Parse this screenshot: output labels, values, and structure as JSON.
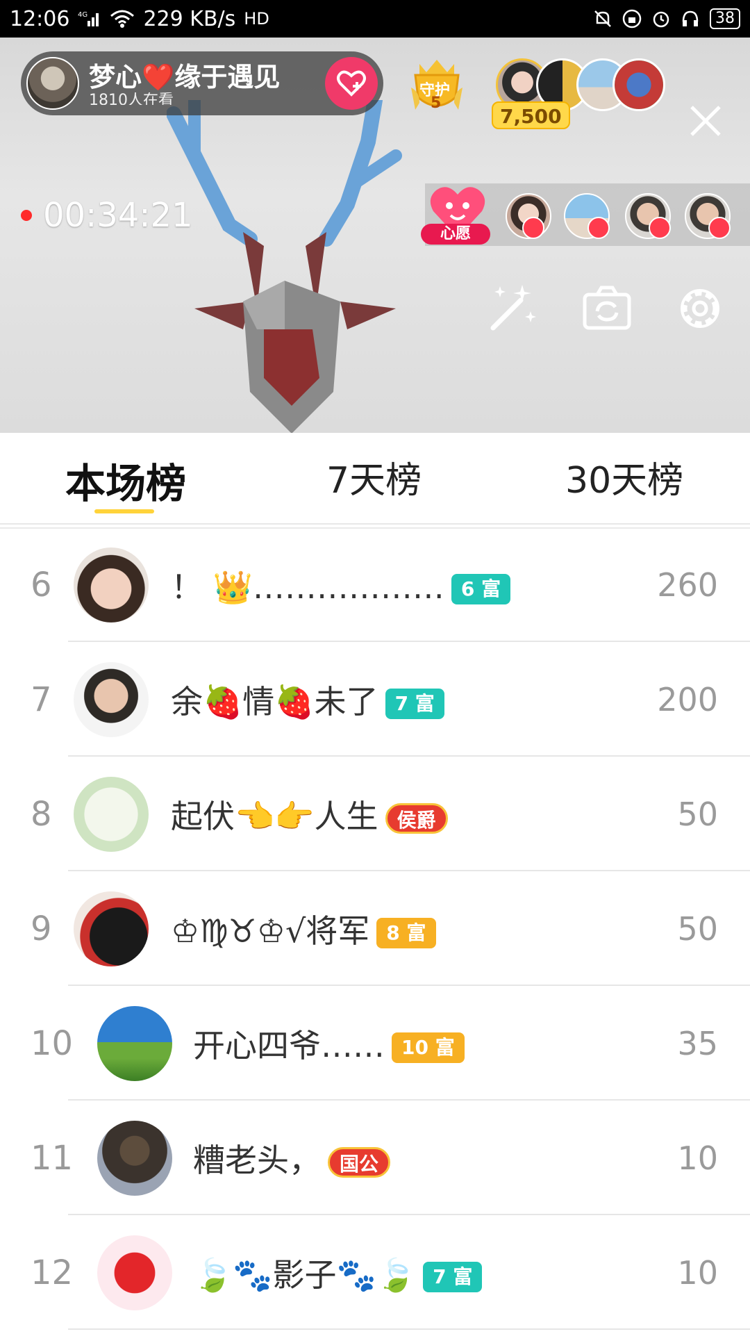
{
  "status_bar": {
    "time": "12:06",
    "network": "4G",
    "speed": "229 KB/s",
    "hd": "HD",
    "battery": "38"
  },
  "live": {
    "host_name": "梦心❤️缘于遇见",
    "watching_text": "1810人在看",
    "guard_label": "守护",
    "guard_count": "5",
    "coins": "7,500",
    "elapsed": "00:34:21",
    "wish_label": "心愿",
    "icons": {
      "beauty": "magic-wand-icon",
      "camera": "camera-flip-icon",
      "settings": "gear-icon",
      "close": "close-icon",
      "follow": "heart-plus-icon"
    }
  },
  "tabs": [
    {
      "label": "本场榜",
      "active": true
    },
    {
      "label": "7天榜",
      "active": false
    },
    {
      "label": "30天榜",
      "active": false
    }
  ],
  "ranking": [
    {
      "rank": "6",
      "name": "！ 👑………………",
      "badge": "6 富",
      "badge_style": "teal",
      "score": "260"
    },
    {
      "rank": "7",
      "name": "余🍓情🍓未了",
      "badge": "7 富",
      "badge_style": "teal",
      "score": "200"
    },
    {
      "rank": "8",
      "name": "起伏👈👉人生",
      "badge": "侯爵",
      "badge_style": "red",
      "score": "50"
    },
    {
      "rank": "9",
      "name": "♔♍♉♔√将军",
      "badge": "8 富",
      "badge_style": "orange",
      "score": "50"
    },
    {
      "rank": "10",
      "name": "开心四爷……",
      "badge": "10 富",
      "badge_style": "orange",
      "score": "35"
    },
    {
      "rank": "11",
      "name": "糟老头，",
      "badge": "国公",
      "badge_style": "red",
      "score": "10"
    },
    {
      "rank": "12",
      "name": "🍃🐾影子🐾🍃",
      "badge": "7 富",
      "badge_style": "teal",
      "score": "10"
    }
  ],
  "colors": {
    "accent_yellow": "#ffd33a",
    "follow_pink": "#f03a69",
    "badge_teal": "#20c6b6",
    "badge_orange": "#f7b023",
    "badge_red": "#e73b2f"
  }
}
